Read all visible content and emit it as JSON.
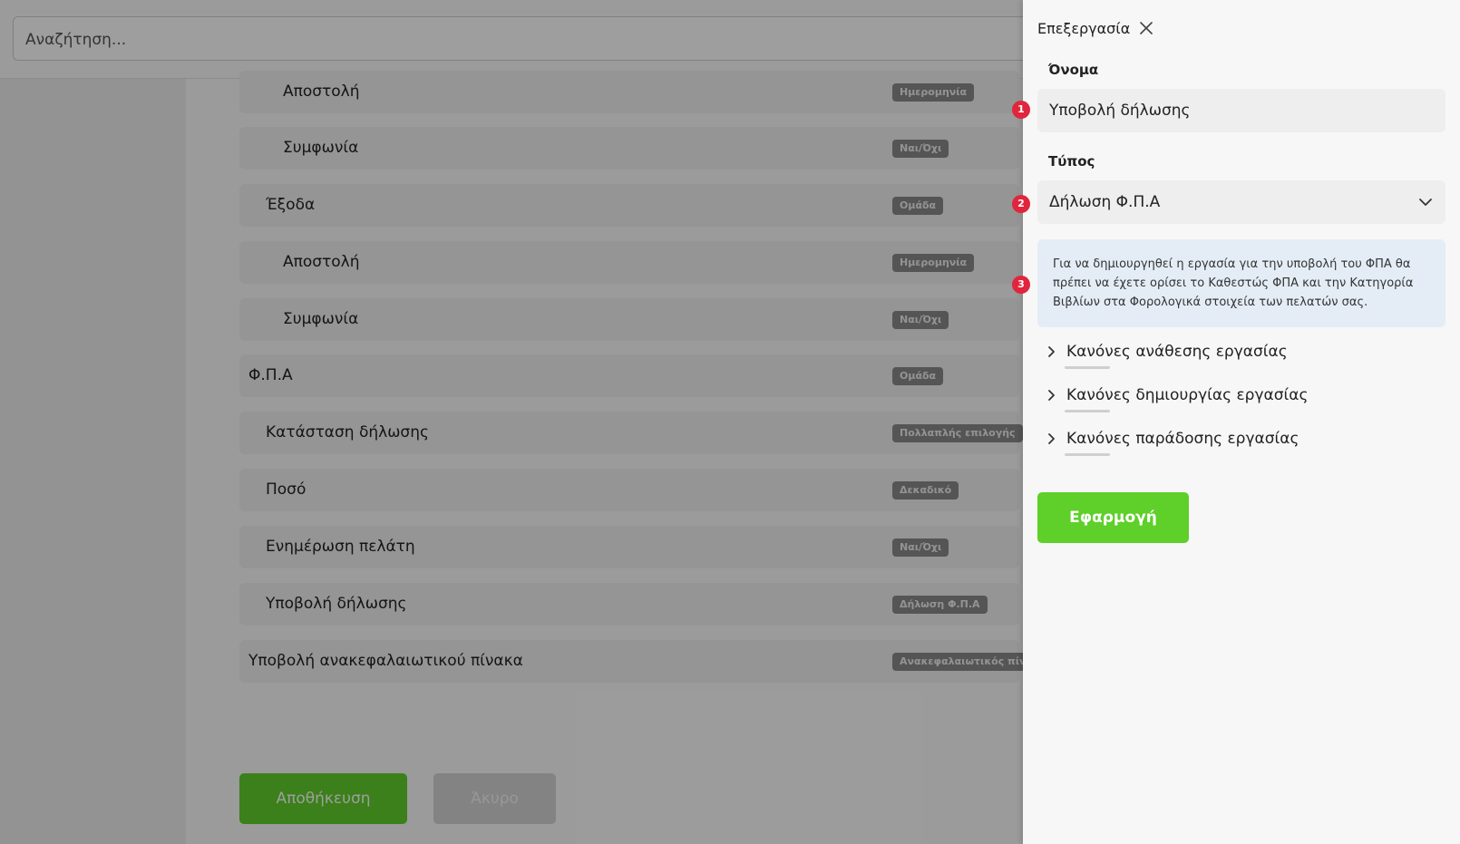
{
  "search": {
    "placeholder": "Αναζήτηση..."
  },
  "rows": [
    {
      "label": "Αποστολή",
      "badge": "Ημερομηνία"
    },
    {
      "label": "Συμφωνία",
      "badge": "Ναι/Όχι"
    },
    {
      "label": "Έξοδα",
      "badge": "Ομάδα"
    },
    {
      "label": "Αποστολή",
      "badge": "Ημερομηνία"
    },
    {
      "label": "Συμφωνία",
      "badge": "Ναι/Όχι"
    },
    {
      "label": "Φ.Π.Α",
      "badge": "Ομάδα"
    },
    {
      "label": "Κατάσταση δήλωσης",
      "badge": "Πολλαπλής επιλογής"
    },
    {
      "label": "Ποσό",
      "badge": "Δεκαδικό"
    },
    {
      "label": "Ενημέρωση πελάτη",
      "badge": "Ναι/Όχι"
    },
    {
      "label": "Υποβολή δήλωσης",
      "badge": "Δήλωση Φ.Π.Α"
    },
    {
      "label": "Υποβολή ανακεφαλαιωτικού πίνακα",
      "badge": "Ανακεφαλαιωτικός πίνακ"
    }
  ],
  "actions": {
    "save": "Αποθήκευση",
    "cancel": "Άκυρο"
  },
  "panel": {
    "title": "Επεξεργασία",
    "name_label": "Όνομα",
    "name_value": "Υποβολή δήλωσης",
    "type_label": "Τύπος",
    "type_value": "Δήλωση Φ.Π.Α",
    "info": "Για να δημιουργηθεί η εργασία για την υποβολή του ΦΠΑ θα πρέπει να έχετε ορίσει το Καθεστώς ΦΠΑ και την Κατηγορία Βιβλίων στα Φορολογικά στοιχεία των πελατών σας.",
    "rules": [
      "Κανόνες ανάθεσης εργασίας",
      "Κανόνες δημιουργίας εργασίας",
      "Κανόνες παράδοσης εργασίας"
    ],
    "apply": "Εφαρμογή"
  },
  "markers": [
    "1",
    "2",
    "3"
  ],
  "colors": {
    "accent_green": "#5fcf2a",
    "marker_red": "#e0263c",
    "info_bg": "#e4edf6"
  },
  "icons": {
    "close": "close-icon",
    "select": "chevron-down-icon",
    "expand": "chevron-right-icon"
  }
}
